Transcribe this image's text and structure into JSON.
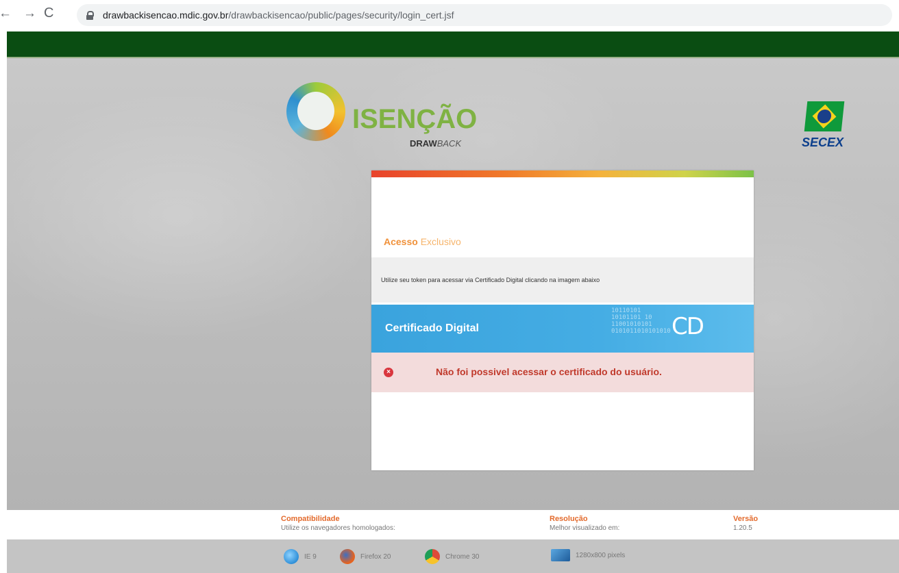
{
  "browser": {
    "back_icon": "←",
    "forward_icon": "→",
    "reload_icon": "C",
    "url_domain": "drawbackisencao.mdic.gov.br",
    "url_path": "/drawbackisencao/public/pages/security/login_cert.jsf"
  },
  "logo": {
    "word": "ISENÇÃO",
    "sub_bold": "DRAW",
    "sub_rest": "BACK"
  },
  "secex": {
    "label": "SECEX"
  },
  "panel": {
    "title_strong": "Acesso",
    "title_light": "Exclusivo",
    "instruction": "Utilize seu token para acessar via Certificado Digital clicando na imagem abaixo",
    "cert_label": "Certificado Digital",
    "cert_bits": "10110101\n10101101 10\n11001010101\n0101011010101010",
    "cert_logo": "CD",
    "error_icon": "×",
    "error_text": "Não foi possivel acessar o certificado do usuário."
  },
  "footer": {
    "compat_title": "Compatibilidade",
    "compat_sub": "Utilize os navegadores homologados:",
    "res_title": "Resolução",
    "res_sub": "Melhor visualizado em:",
    "ver_title": "Versão",
    "ver_value": "1.20.5",
    "browsers": [
      {
        "icon": "ie-icon",
        "label": "IE 9",
        "color": "#2f8fd8"
      },
      {
        "icon": "firefox-icon",
        "label": "Firefox 20",
        "color": "#e6631f"
      },
      {
        "icon": "chrome-icon",
        "label": "Chrome 30",
        "color": "#dd4b39"
      }
    ],
    "resolution": "1280x800 pixels"
  }
}
